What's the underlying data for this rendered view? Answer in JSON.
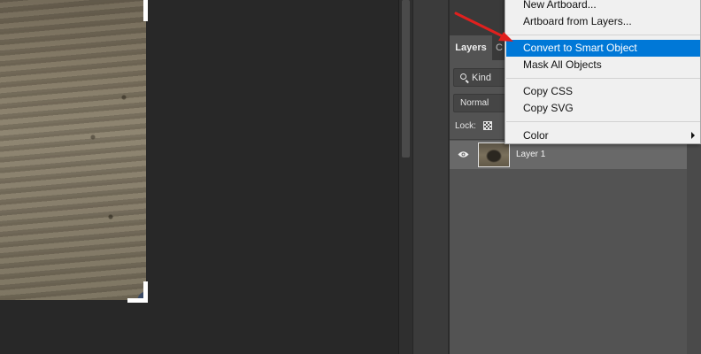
{
  "layers_panel": {
    "tabs": [
      {
        "label": "Layers",
        "active": true
      },
      {
        "label": "C",
        "active": false
      }
    ],
    "filter_kind": "Kind",
    "blend_mode": "Normal",
    "lock_label": "Lock:",
    "layers": [
      {
        "name": "Layer 1",
        "visible": true
      }
    ]
  },
  "context_menu": {
    "items": [
      {
        "label": "New Artboard...",
        "highlighted": false
      },
      {
        "label": "Artboard from Layers...",
        "highlighted": false
      },
      {
        "label": "Convert to Smart Object",
        "highlighted": true
      },
      {
        "label": "Mask All Objects",
        "highlighted": false
      },
      {
        "label": "Copy CSS",
        "highlighted": false
      },
      {
        "label": "Copy SVG",
        "highlighted": false
      },
      {
        "label": "Color",
        "highlighted": false,
        "has_submenu": true
      }
    ]
  },
  "colors": {
    "menu_highlight": "#0078d7",
    "annotation_arrow": "#e0201e",
    "panel_bg": "#535353",
    "canvas_bg": "#282828"
  }
}
